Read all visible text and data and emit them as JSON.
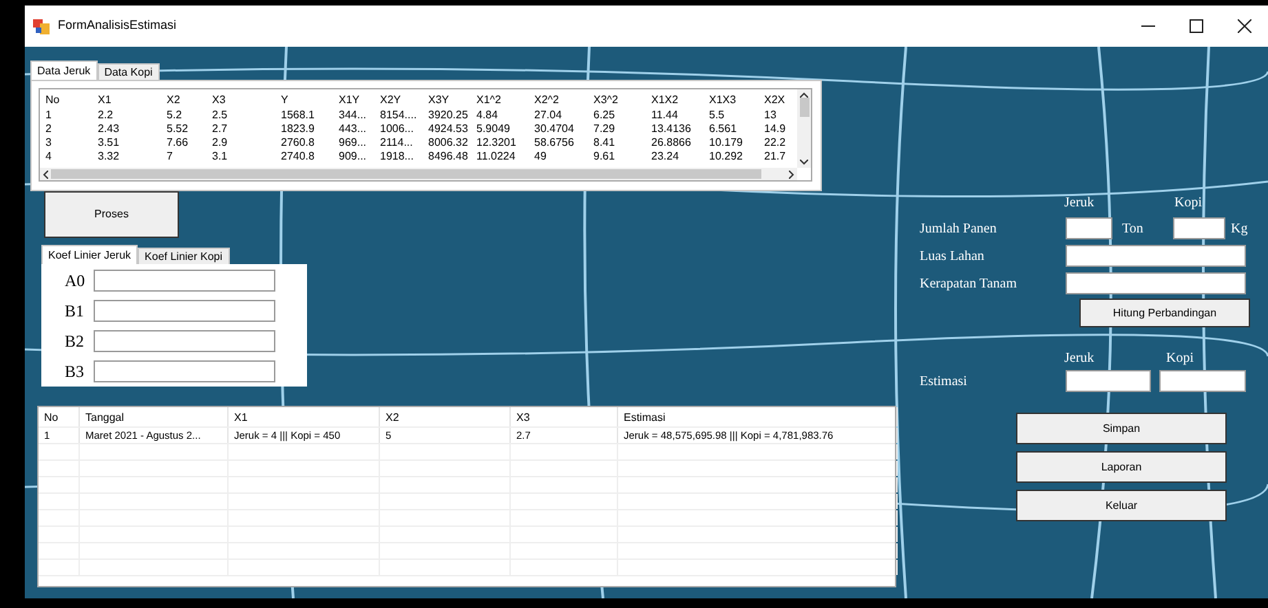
{
  "window": {
    "title": "FormAnalisisEstimasi"
  },
  "data_tabs": [
    {
      "label": "Data Jeruk",
      "selected": true
    },
    {
      "label": "Data Kopi",
      "selected": false
    }
  ],
  "data_table": {
    "columns": [
      "No",
      "X1",
      "X2",
      "X3",
      "Y",
      "X1Y",
      "X2Y",
      "X3Y",
      "X1^2",
      "X2^2",
      "X3^2",
      "X1X2",
      "X1X3",
      "X2X"
    ],
    "rows": [
      [
        "1",
        "2.2",
        "5.2",
        "2.5",
        "1568.1",
        "344...",
        "8154....",
        "3920.25",
        "4.84",
        "27.04",
        "6.25",
        "11.44",
        "5.5",
        "13"
      ],
      [
        "2",
        "2.43",
        "5.52",
        "2.7",
        "1823.9",
        "443...",
        "1006...",
        "4924.53",
        "5.9049",
        "30.4704",
        "7.29",
        "13.4136",
        "6.561",
        "14.9"
      ],
      [
        "3",
        "3.51",
        "7.66",
        "2.9",
        "2760.8",
        "969...",
        "2114...",
        "8006.32",
        "12.3201",
        "58.6756",
        "8.41",
        "26.8866",
        "10.179",
        "22.2"
      ],
      [
        "4",
        "3.32",
        "7",
        "3.1",
        "2740.8",
        "909...",
        "1918...",
        "8496.48",
        "11.0224",
        "49",
        "9.61",
        "23.24",
        "10.292",
        "21.7"
      ]
    ]
  },
  "proses_button": "Proses",
  "koef_tabs": [
    {
      "label": "Koef Linier Jeruk",
      "selected": true
    },
    {
      "label": "Koef Linier Kopi",
      "selected": false
    }
  ],
  "koef_fields": [
    {
      "label": "A0"
    },
    {
      "label": "B1"
    },
    {
      "label": "B2"
    },
    {
      "label": "B3"
    }
  ],
  "form": {
    "jeruk_heading": "Jeruk",
    "kopi_heading": "Kopi",
    "jumlah_panen": "Jumlah Panen",
    "ton": "Ton",
    "kg": "Kg",
    "luas_lahan": "Luas Lahan",
    "kerapatan_tanam": "Kerapatan Tanam",
    "hitung_button": "Hitung Perbandingan",
    "estimasi_jeruk_heading": "Jeruk",
    "estimasi_kopi_heading": "Kopi",
    "estimasi": "Estimasi"
  },
  "buttons": [
    "Simpan",
    "Laporan",
    "Keluar"
  ],
  "result_table": {
    "columns": [
      "No",
      "Tanggal",
      "X1",
      "X2",
      "X3",
      "Estimasi"
    ],
    "rows": [
      [
        "1",
        "Maret 2021 - Agustus 2...",
        "Jeruk = 4 ||| Kopi = 450",
        "5",
        "2.7",
        "Jeruk = 48,575,695.98 ||| Kopi = 4,781,983.76"
      ]
    ]
  }
}
